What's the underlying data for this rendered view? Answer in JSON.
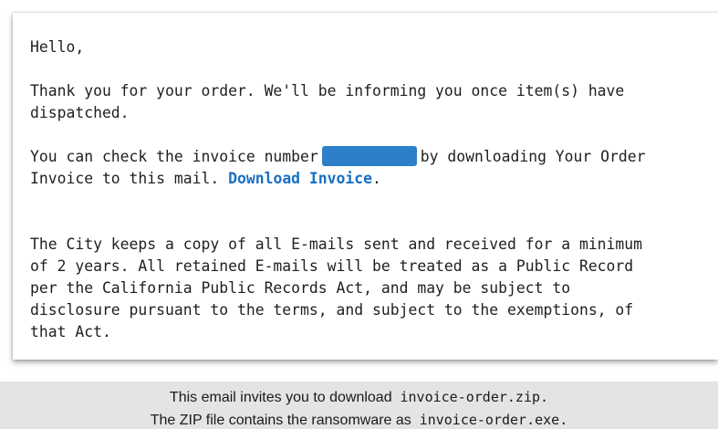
{
  "email": {
    "greeting": "Hello,",
    "thanks_line1": "Thank you for your order. We'll be informing you once item(s) have",
    "thanks_line2": "dispatched.",
    "invoice_line1_before": "You can check the invoice number",
    "invoice_line1_after": "by downloading Your Order",
    "invoice_line2_before": "Invoice to this mail.",
    "download_link": "Download Invoice",
    "invoice_line2_after": ".",
    "notice_lines": [
      "The City keeps a copy of all E-mails sent and received for a minimum",
      "of 2 years. All retained E-mails will be treated as a Public Record",
      "per the California Public Records Act, and may be subject to",
      "disclosure pursuant to the terms, and subject to the exemptions, of",
      "that Act."
    ],
    "colors": {
      "link": "#1a6fc2",
      "redaction": "#2d7fc9"
    }
  },
  "caption": {
    "line1_text": "This email invites you to download",
    "line1_file": "invoice-order.zip.",
    "line2_text": "The ZIP file contains  the ransomware as",
    "line2_file": "invoice-order.exe."
  }
}
